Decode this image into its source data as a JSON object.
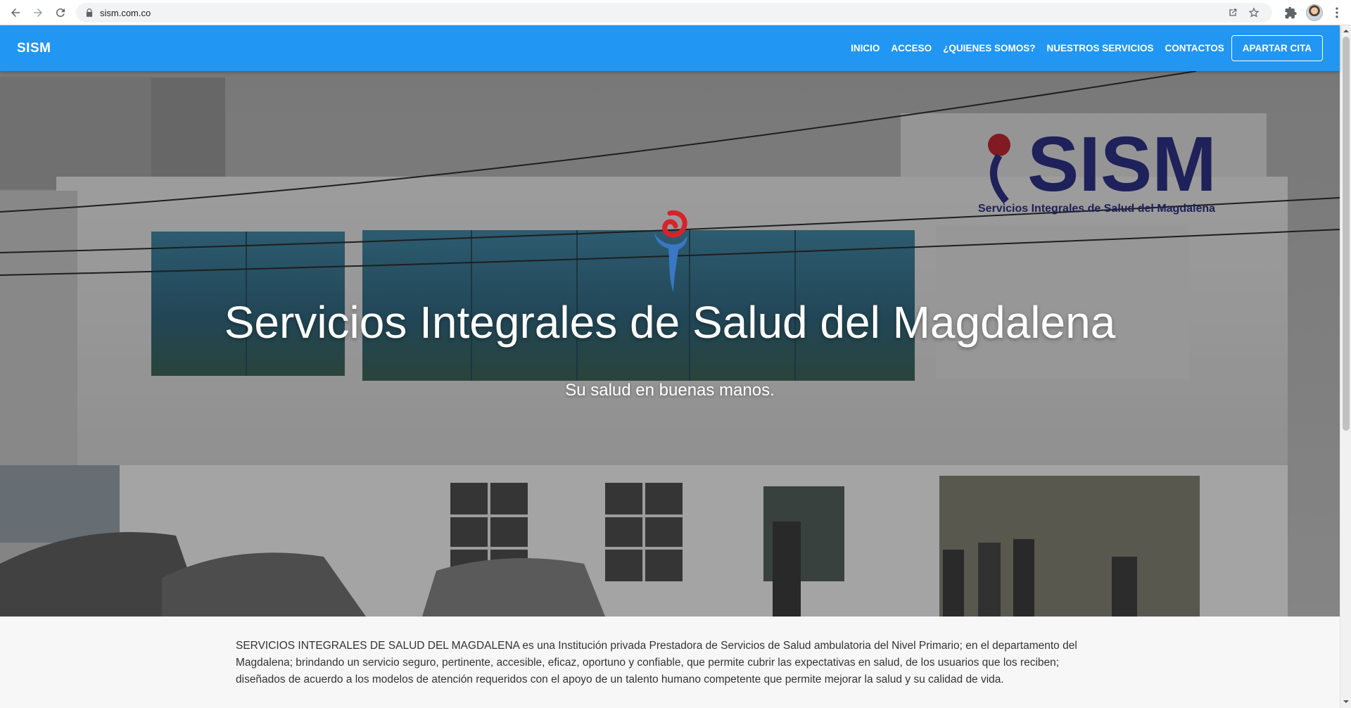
{
  "browser": {
    "url": "sism.com.co",
    "icons": [
      "back-arrow-icon",
      "forward-arrow-icon",
      "reload-icon",
      "lock-icon",
      "share-icon",
      "star-icon",
      "extensions-icon",
      "profile-avatar",
      "kebab-menu-icon"
    ]
  },
  "navbar": {
    "brand": "SISM",
    "links": [
      "INICIO",
      "ACCESO",
      "¿QUIENES SOMOS?",
      "NUESTROS SERVICIOS",
      "CONTACTOS"
    ],
    "cta": "APARTAR CITA",
    "color": "#2196f3"
  },
  "hero": {
    "title": "Servicios Integrales de Salud del Magdalena",
    "subtitle": "Su salud en buenas manos.",
    "building_sign": "SISM",
    "building_sign_sub": "Servicios Integrales de Salud del Magdalena"
  },
  "intro": {
    "text": "SERVICIOS INTEGRALES DE SALUD DEL MAGDALENA es una Institución privada Prestadora de Servicios de Salud ambulatoria del Nivel Primario; en el departamento del Magdalena; brindando un servicio seguro, pertinente, accesible, eficaz, oportuno y confiable, que permite cubrir las expectativas en salud, de los usuarios que los reciben; diseñados de acuerdo a los modelos de atención requeridos con el apoyo de un talento humano competente que permite mejorar la salud y su calidad de vida."
  }
}
